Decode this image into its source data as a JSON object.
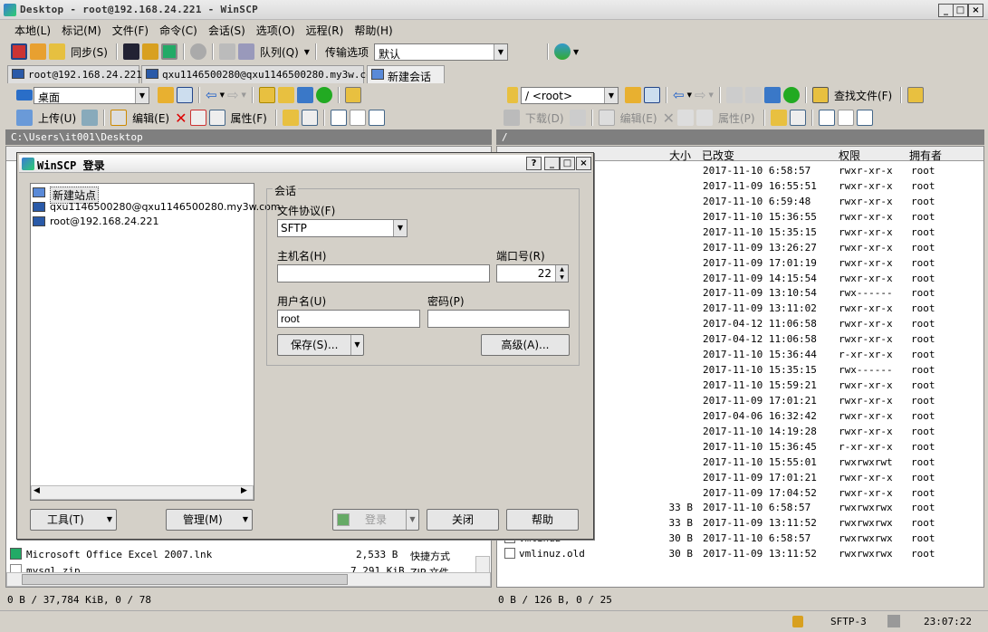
{
  "window": {
    "title": "Desktop - root@192.168.24.221 - WinSCP"
  },
  "menu": [
    "本地(L)",
    "标记(M)",
    "文件(F)",
    "命令(C)",
    "会话(S)",
    "选项(O)",
    "远程(R)",
    "帮助(H)"
  ],
  "toolbar": {
    "sync": "同步(S)",
    "queue": "队列(Q)",
    "transfer_label": "传输选项",
    "transfer_value": "默认"
  },
  "tabs": [
    "root@192.168.24.221",
    "qxu1146500280@qxu1146500280.my3w.com",
    "新建会话"
  ],
  "left": {
    "location": "桌面",
    "upload": "上传(U)",
    "edit": "编辑(E)",
    "props": "属性(F)",
    "path": "C:\\Users\\it001\\Desktop",
    "rows": [
      {
        "name": "Microsoft Office Excel 2007.lnk",
        "size": "2,533 B",
        "type": "快捷方式"
      },
      {
        "name": "mysql.zip",
        "size": "7,291 KiB",
        "type": "ZIP 文件"
      }
    ],
    "status": "0 B / 37,784 KiB,  0 / 78"
  },
  "right": {
    "location": "/ <root>",
    "find": "查找文件(F)",
    "download": "下载(D)",
    "edit": "编辑(E)",
    "props": "属性(P)",
    "path": "/",
    "headers": {
      "size": "大小",
      "changed": "已改变",
      "rights": "权限",
      "owner": "拥有者"
    },
    "rows": [
      {
        "name": "",
        "size": "",
        "date": "2017-11-10 6:58:57",
        "rights": "rwxr-xr-x",
        "owner": "root"
      },
      {
        "name": "",
        "size": "",
        "date": "2017-11-09 16:55:51",
        "rights": "rwxr-xr-x",
        "owner": "root"
      },
      {
        "name": "",
        "size": "",
        "date": "2017-11-10 6:59:48",
        "rights": "rwxr-xr-x",
        "owner": "root"
      },
      {
        "name": "",
        "size": "",
        "date": "2017-11-10 15:36:55",
        "rights": "rwxr-xr-x",
        "owner": "root"
      },
      {
        "name": "",
        "size": "",
        "date": "2017-11-10 15:35:15",
        "rights": "rwxr-xr-x",
        "owner": "root"
      },
      {
        "name": "",
        "size": "",
        "date": "2017-11-09 13:26:27",
        "rights": "rwxr-xr-x",
        "owner": "root"
      },
      {
        "name": "",
        "size": "",
        "date": "2017-11-09 17:01:19",
        "rights": "rwxr-xr-x",
        "owner": "root"
      },
      {
        "name": "",
        "size": "",
        "date": "2017-11-09 14:15:54",
        "rights": "rwxr-xr-x",
        "owner": "root"
      },
      {
        "name": "",
        "size": "",
        "date": "2017-11-09 13:10:54",
        "rights": "rwx------",
        "owner": "root"
      },
      {
        "name": "",
        "size": "",
        "date": "2017-11-09 13:11:02",
        "rights": "rwxr-xr-x",
        "owner": "root"
      },
      {
        "name": "",
        "size": "",
        "date": "2017-04-12 11:06:58",
        "rights": "rwxr-xr-x",
        "owner": "root"
      },
      {
        "name": "",
        "size": "",
        "date": "2017-04-12 11:06:58",
        "rights": "rwxr-xr-x",
        "owner": "root"
      },
      {
        "name": "",
        "size": "",
        "date": "2017-11-10 15:36:44",
        "rights": "r-xr-xr-x",
        "owner": "root"
      },
      {
        "name": "",
        "size": "",
        "date": "2017-11-10 15:35:15",
        "rights": "rwx------",
        "owner": "root"
      },
      {
        "name": "",
        "size": "",
        "date": "2017-11-10 15:59:21",
        "rights": "rwxr-xr-x",
        "owner": "root"
      },
      {
        "name": "",
        "size": "",
        "date": "2017-11-09 17:01:21",
        "rights": "rwxr-xr-x",
        "owner": "root"
      },
      {
        "name": "",
        "size": "",
        "date": "2017-04-06 16:32:42",
        "rights": "rwxr-xr-x",
        "owner": "root"
      },
      {
        "name": "",
        "size": "",
        "date": "2017-11-10 14:19:28",
        "rights": "rwxr-xr-x",
        "owner": "root"
      },
      {
        "name": "",
        "size": "",
        "date": "2017-11-10 15:36:45",
        "rights": "r-xr-xr-x",
        "owner": "root"
      },
      {
        "name": "",
        "size": "",
        "date": "2017-11-10 15:55:01",
        "rights": "rwxrwxrwt",
        "owner": "root"
      },
      {
        "name": "",
        "size": "",
        "date": "2017-11-09 17:01:21",
        "rights": "rwxr-xr-x",
        "owner": "root"
      },
      {
        "name": "",
        "size": "",
        "date": "2017-11-09 17:04:52",
        "rights": "rwxr-xr-x",
        "owner": "root"
      },
      {
        "name": "",
        "size": "33 B",
        "date": "2017-11-10 6:58:57",
        "rights": "rwxrwxrwx",
        "owner": "root"
      },
      {
        "name": "",
        "size": "33 B",
        "date": "2017-11-09 13:11:52",
        "rights": "rwxrwxrwx",
        "owner": "root"
      },
      {
        "name": "vmlinuz",
        "size": "30 B",
        "date": "2017-11-10 6:58:57",
        "rights": "rwxrwxrwx",
        "owner": "root"
      },
      {
        "name": "vmlinuz.old",
        "size": "30 B",
        "date": "2017-11-09 13:11:52",
        "rights": "rwxrwxrwx",
        "owner": "root"
      }
    ],
    "status": "0 B / 126 B,  0 / 25"
  },
  "statusbar": {
    "protocol": "SFTP-3",
    "time": "23:07:22"
  },
  "dialog": {
    "title": "WinSCP 登录",
    "sites": [
      "新建站点",
      "qxu1146500280@qxu1146500280.my3w.com",
      "root@192.168.24.221"
    ],
    "session_group": "会话",
    "protocol_label": "文件协议(F)",
    "protocol_value": "SFTP",
    "host_label": "主机名(H)",
    "host_value": "",
    "port_label": "端口号(R)",
    "port_value": "22",
    "user_label": "用户名(U)",
    "user_value": "root",
    "pass_label": "密码(P)",
    "pass_value": "",
    "save": "保存(S)...",
    "advanced": "高级(A)...",
    "tools": "工具(T)",
    "manage": "管理(M)",
    "login": "登录",
    "close": "关闭",
    "help": "帮助"
  }
}
